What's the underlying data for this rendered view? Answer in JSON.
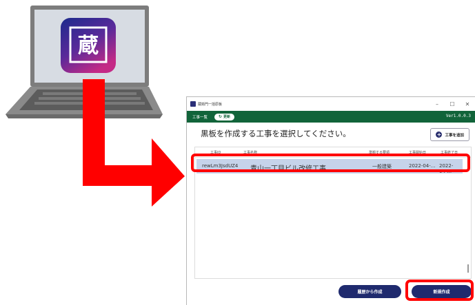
{
  "app_icon": {
    "glyph": "蔵",
    "colors": {
      "top": "#1c2b8c",
      "bottom": "#c42a86"
    }
  },
  "window": {
    "title": "蔵衛門一括原板",
    "controls": {
      "minimize": "–",
      "maximize": "☐",
      "close": "✕"
    }
  },
  "appbar": {
    "title": "工事一覧",
    "update_label": "更新",
    "version": "Ver1.0.0.3"
  },
  "page": {
    "heading": "黒板を作成する工事を選択してください。",
    "add_button": "工事を追加"
  },
  "table": {
    "columns": [
      "工事ID",
      "工事名称",
      "準拠する要領",
      "工事開始日",
      "工事終了日"
    ],
    "rows": [
      {
        "id": "rewLm3JsdUZ4",
        "name": "青山一丁目ビル改修工事",
        "standard": "一般建築",
        "start": "2022-04-...",
        "end": "2022-04-..."
      }
    ]
  },
  "buttons": {
    "from_history": "履歴から作成",
    "new_create": "新規作成"
  },
  "colors": {
    "appbar": "#11643a",
    "primary": "#1f2a6e",
    "highlight": "#ff0000",
    "row_selected": "#c6d3ea"
  }
}
